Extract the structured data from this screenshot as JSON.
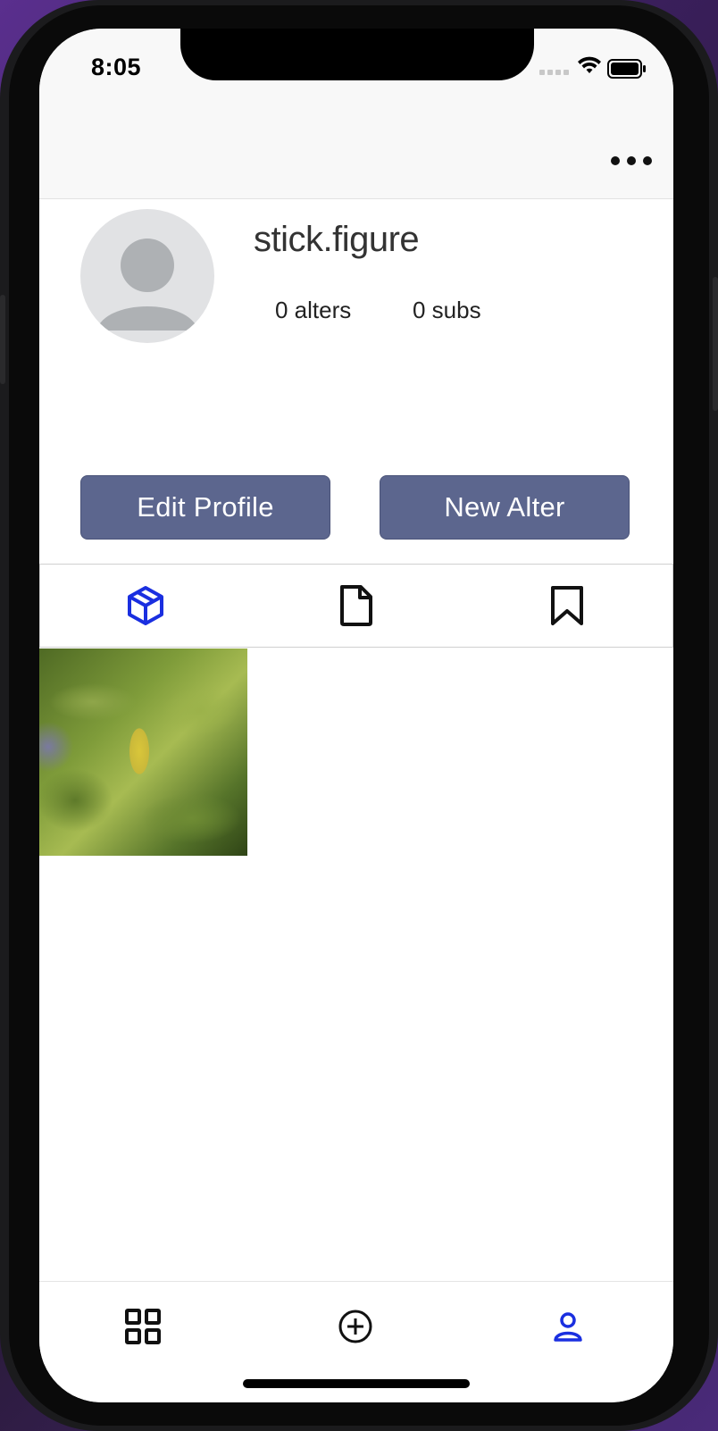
{
  "status_bar": {
    "time": "8:05",
    "icons": [
      "cellular-signal-icon",
      "wifi-icon",
      "battery-icon"
    ]
  },
  "nav_bar": {
    "more_icon": "ellipsis-icon"
  },
  "profile": {
    "username": "stick.figure",
    "avatar_icon": "default-avatar-icon",
    "alters_count": "0 alters",
    "subs_count": "0 subs"
  },
  "actions": {
    "edit_profile_label": "Edit Profile",
    "new_alter_label": "New Alter"
  },
  "content_tabs": [
    {
      "icon": "cube-icon",
      "active": true
    },
    {
      "icon": "document-icon",
      "active": false
    },
    {
      "icon": "bookmark-icon",
      "active": false
    }
  ],
  "grid_items": [
    {
      "type": "photo",
      "subject": "green leaves with a yellow leaf"
    }
  ],
  "bottom_tabs": [
    {
      "icon": "grid-icon",
      "active": false
    },
    {
      "icon": "plus-circle-icon",
      "active": false
    },
    {
      "icon": "person-icon",
      "active": true
    }
  ],
  "colors": {
    "accent": "#1a2fe0",
    "button_bg": "#5c668e",
    "icon_default": "#111111"
  }
}
